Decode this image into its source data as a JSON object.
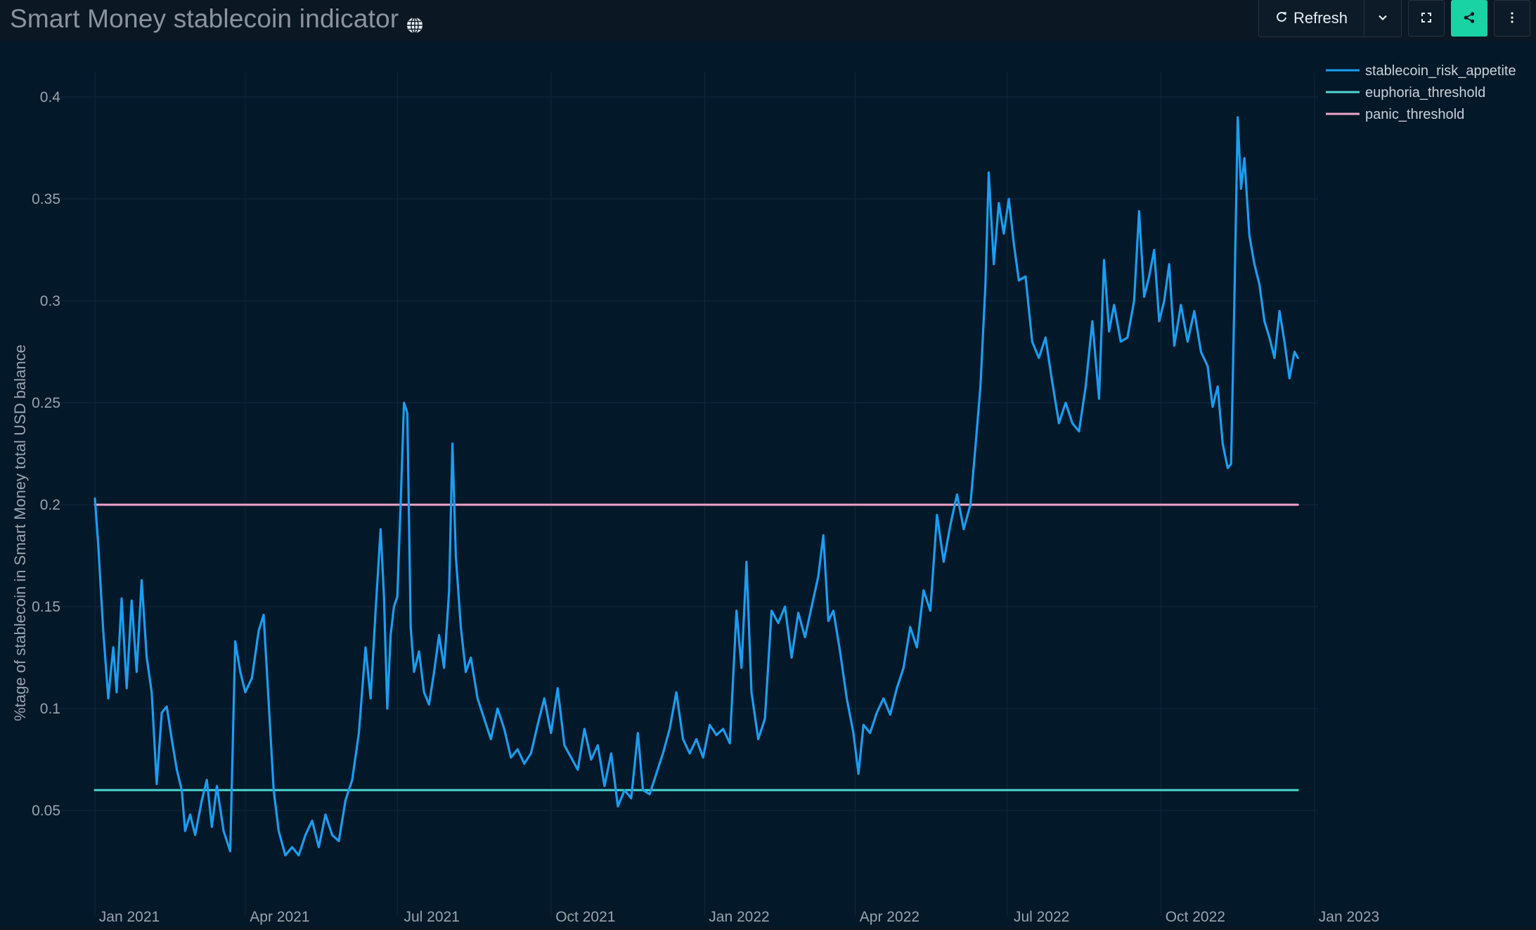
{
  "header": {
    "title": "Smart Money stablecoin indicator",
    "title_icon": "globe-icon",
    "refresh_label": "Refresh",
    "refresh_icon": "refresh-icon",
    "dropdown_icon": "chevron-down-icon",
    "fullscreen_icon": "expand-icon",
    "share_icon": "share-icon",
    "more_icon": "kebab-menu-icon"
  },
  "colors": {
    "page_bg": "#0b1723",
    "plot_bg": "#031829",
    "risk": "#1a9ef2",
    "euphoria": "#4dd6d1",
    "panic": "#f0a3c9",
    "accent": "#19d3a4"
  },
  "chart_data": {
    "type": "line",
    "title": "",
    "xlabel": "",
    "ylabel": "%tage of stablecoin in Smart Money total USD balance",
    "xlim": [
      "2021-01-01",
      "2023-01-01"
    ],
    "ylim": [
      0,
      0.41
    ],
    "x_ticks": [
      "Jan 2021",
      "Apr 2021",
      "Jul 2021",
      "Oct 2021",
      "Jan 2022",
      "Apr 2022",
      "Jul 2022",
      "Oct 2022",
      "Jan 2023"
    ],
    "y_ticks": [
      "0.05",
      "0.1",
      "0.15",
      "0.2",
      "0.25",
      "0.3",
      "0.35",
      "0.4"
    ],
    "grid": true,
    "legend_position": "top-right",
    "series": [
      {
        "name": "stablecoin_risk_appetite",
        "color": "#1a9ef2",
        "points": [
          [
            "2021-01-01",
            0.203
          ],
          [
            "2021-01-03",
            0.18
          ],
          [
            "2021-01-06",
            0.138
          ],
          [
            "2021-01-09",
            0.105
          ],
          [
            "2021-01-12",
            0.13
          ],
          [
            "2021-01-14",
            0.108
          ],
          [
            "2021-01-17",
            0.154
          ],
          [
            "2021-01-20",
            0.11
          ],
          [
            "2021-01-23",
            0.153
          ],
          [
            "2021-01-26",
            0.118
          ],
          [
            "2021-01-29",
            0.163
          ],
          [
            "2021-02-01",
            0.125
          ],
          [
            "2021-02-04",
            0.108
          ],
          [
            "2021-02-07",
            0.063
          ],
          [
            "2021-02-10",
            0.098
          ],
          [
            "2021-02-13",
            0.101
          ],
          [
            "2021-02-16",
            0.085
          ],
          [
            "2021-02-19",
            0.07
          ],
          [
            "2021-02-22",
            0.06
          ],
          [
            "2021-02-24",
            0.04
          ],
          [
            "2021-02-27",
            0.048
          ],
          [
            "2021-03-02",
            0.038
          ],
          [
            "2021-03-06",
            0.055
          ],
          [
            "2021-03-09",
            0.065
          ],
          [
            "2021-03-12",
            0.042
          ],
          [
            "2021-03-15",
            0.062
          ],
          [
            "2021-03-19",
            0.04
          ],
          [
            "2021-03-23",
            0.03
          ],
          [
            "2021-03-26",
            0.133
          ],
          [
            "2021-03-29",
            0.118
          ],
          [
            "2021-04-01",
            0.108
          ],
          [
            "2021-04-05",
            0.115
          ],
          [
            "2021-04-09",
            0.138
          ],
          [
            "2021-04-12",
            0.146
          ],
          [
            "2021-04-15",
            0.103
          ],
          [
            "2021-04-18",
            0.06
          ],
          [
            "2021-04-21",
            0.04
          ],
          [
            "2021-04-25",
            0.028
          ],
          [
            "2021-04-29",
            0.032
          ],
          [
            "2021-05-03",
            0.028
          ],
          [
            "2021-05-07",
            0.038
          ],
          [
            "2021-05-11",
            0.045
          ],
          [
            "2021-05-15",
            0.032
          ],
          [
            "2021-05-19",
            0.048
          ],
          [
            "2021-05-23",
            0.038
          ],
          [
            "2021-05-27",
            0.035
          ],
          [
            "2021-05-31",
            0.055
          ],
          [
            "2021-06-04",
            0.065
          ],
          [
            "2021-06-08",
            0.088
          ],
          [
            "2021-06-12",
            0.13
          ],
          [
            "2021-06-15",
            0.105
          ],
          [
            "2021-06-18",
            0.148
          ],
          [
            "2021-06-21",
            0.188
          ],
          [
            "2021-06-23",
            0.155
          ],
          [
            "2021-06-25",
            0.1
          ],
          [
            "2021-06-27",
            0.136
          ],
          [
            "2021-06-29",
            0.15
          ],
          [
            "2021-07-01",
            0.155
          ],
          [
            "2021-07-03",
            0.2
          ],
          [
            "2021-07-05",
            0.25
          ],
          [
            "2021-07-07",
            0.245
          ],
          [
            "2021-07-09",
            0.14
          ],
          [
            "2021-07-11",
            0.118
          ],
          [
            "2021-07-14",
            0.128
          ],
          [
            "2021-07-17",
            0.108
          ],
          [
            "2021-07-20",
            0.102
          ],
          [
            "2021-07-23",
            0.118
          ],
          [
            "2021-07-26",
            0.136
          ],
          [
            "2021-07-29",
            0.12
          ],
          [
            "2021-08-01",
            0.158
          ],
          [
            "2021-08-03",
            0.23
          ],
          [
            "2021-08-05",
            0.175
          ],
          [
            "2021-08-08",
            0.14
          ],
          [
            "2021-08-11",
            0.118
          ],
          [
            "2021-08-14",
            0.125
          ],
          [
            "2021-08-18",
            0.105
          ],
          [
            "2021-08-22",
            0.095
          ],
          [
            "2021-08-26",
            0.085
          ],
          [
            "2021-08-30",
            0.1
          ],
          [
            "2021-09-03",
            0.09
          ],
          [
            "2021-09-07",
            0.076
          ],
          [
            "2021-09-11",
            0.08
          ],
          [
            "2021-09-15",
            0.073
          ],
          [
            "2021-09-19",
            0.078
          ],
          [
            "2021-09-23",
            0.092
          ],
          [
            "2021-09-27",
            0.105
          ],
          [
            "2021-10-01",
            0.088
          ],
          [
            "2021-10-05",
            0.11
          ],
          [
            "2021-10-09",
            0.082
          ],
          [
            "2021-10-13",
            0.076
          ],
          [
            "2021-10-17",
            0.07
          ],
          [
            "2021-10-21",
            0.09
          ],
          [
            "2021-10-25",
            0.075
          ],
          [
            "2021-10-29",
            0.082
          ],
          [
            "2021-11-02",
            0.062
          ],
          [
            "2021-11-06",
            0.078
          ],
          [
            "2021-11-10",
            0.052
          ],
          [
            "2021-11-14",
            0.06
          ],
          [
            "2021-11-18",
            0.056
          ],
          [
            "2021-11-22",
            0.088
          ],
          [
            "2021-11-25",
            0.06
          ],
          [
            "2021-11-29",
            0.058
          ],
          [
            "2021-12-03",
            0.068
          ],
          [
            "2021-12-07",
            0.078
          ],
          [
            "2021-12-11",
            0.09
          ],
          [
            "2021-12-15",
            0.108
          ],
          [
            "2021-12-19",
            0.085
          ],
          [
            "2021-12-23",
            0.078
          ],
          [
            "2021-12-27",
            0.085
          ],
          [
            "2021-12-31",
            0.076
          ],
          [
            "2022-01-04",
            0.092
          ],
          [
            "2022-01-08",
            0.087
          ],
          [
            "2022-01-12",
            0.09
          ],
          [
            "2022-01-16",
            0.083
          ],
          [
            "2022-01-20",
            0.148
          ],
          [
            "2022-01-23",
            0.12
          ],
          [
            "2022-01-26",
            0.172
          ],
          [
            "2022-01-29",
            0.108
          ],
          [
            "2022-02-02",
            0.085
          ],
          [
            "2022-02-06",
            0.095
          ],
          [
            "2022-02-10",
            0.148
          ],
          [
            "2022-02-14",
            0.142
          ],
          [
            "2022-02-18",
            0.15
          ],
          [
            "2022-02-22",
            0.125
          ],
          [
            "2022-02-26",
            0.147
          ],
          [
            "2022-03-02",
            0.135
          ],
          [
            "2022-03-06",
            0.15
          ],
          [
            "2022-03-10",
            0.165
          ],
          [
            "2022-03-13",
            0.185
          ],
          [
            "2022-03-16",
            0.143
          ],
          [
            "2022-03-19",
            0.148
          ],
          [
            "2022-03-23",
            0.128
          ],
          [
            "2022-03-27",
            0.105
          ],
          [
            "2022-03-31",
            0.088
          ],
          [
            "2022-04-03",
            0.068
          ],
          [
            "2022-04-06",
            0.092
          ],
          [
            "2022-04-10",
            0.088
          ],
          [
            "2022-04-14",
            0.098
          ],
          [
            "2022-04-18",
            0.105
          ],
          [
            "2022-04-22",
            0.097
          ],
          [
            "2022-04-26",
            0.11
          ],
          [
            "2022-04-30",
            0.12
          ],
          [
            "2022-05-04",
            0.14
          ],
          [
            "2022-05-08",
            0.13
          ],
          [
            "2022-05-12",
            0.158
          ],
          [
            "2022-05-16",
            0.148
          ],
          [
            "2022-05-20",
            0.195
          ],
          [
            "2022-05-24",
            0.172
          ],
          [
            "2022-05-28",
            0.19
          ],
          [
            "2022-06-01",
            0.205
          ],
          [
            "2022-06-05",
            0.188
          ],
          [
            "2022-06-09",
            0.2
          ],
          [
            "2022-06-12",
            0.228
          ],
          [
            "2022-06-15",
            0.258
          ],
          [
            "2022-06-18",
            0.308
          ],
          [
            "2022-06-20",
            0.363
          ],
          [
            "2022-06-23",
            0.318
          ],
          [
            "2022-06-26",
            0.348
          ],
          [
            "2022-06-29",
            0.333
          ],
          [
            "2022-07-02",
            0.35
          ],
          [
            "2022-07-05",
            0.328
          ],
          [
            "2022-07-08",
            0.31
          ],
          [
            "2022-07-12",
            0.312
          ],
          [
            "2022-07-16",
            0.28
          ],
          [
            "2022-07-20",
            0.272
          ],
          [
            "2022-07-24",
            0.282
          ],
          [
            "2022-07-28",
            0.26
          ],
          [
            "2022-08-01",
            0.24
          ],
          [
            "2022-08-05",
            0.25
          ],
          [
            "2022-08-09",
            0.24
          ],
          [
            "2022-08-13",
            0.236
          ],
          [
            "2022-08-17",
            0.258
          ],
          [
            "2022-08-21",
            0.29
          ],
          [
            "2022-08-25",
            0.252
          ],
          [
            "2022-08-28",
            0.32
          ],
          [
            "2022-08-31",
            0.285
          ],
          [
            "2022-09-03",
            0.298
          ],
          [
            "2022-09-07",
            0.28
          ],
          [
            "2022-09-11",
            0.282
          ],
          [
            "2022-09-15",
            0.3
          ],
          [
            "2022-09-18",
            0.344
          ],
          [
            "2022-09-21",
            0.302
          ],
          [
            "2022-09-24",
            0.312
          ],
          [
            "2022-09-27",
            0.325
          ],
          [
            "2022-09-30",
            0.29
          ],
          [
            "2022-10-03",
            0.3
          ],
          [
            "2022-10-06",
            0.318
          ],
          [
            "2022-10-09",
            0.278
          ],
          [
            "2022-10-13",
            0.298
          ],
          [
            "2022-10-17",
            0.28
          ],
          [
            "2022-10-21",
            0.295
          ],
          [
            "2022-10-25",
            0.275
          ],
          [
            "2022-10-29",
            0.268
          ],
          [
            "2022-11-01",
            0.248
          ],
          [
            "2022-11-04",
            0.258
          ],
          [
            "2022-11-07",
            0.23
          ],
          [
            "2022-11-10",
            0.218
          ],
          [
            "2022-11-12",
            0.22
          ],
          [
            "2022-11-14",
            0.3
          ],
          [
            "2022-11-16",
            0.39
          ],
          [
            "2022-11-18",
            0.355
          ],
          [
            "2022-11-20",
            0.37
          ],
          [
            "2022-11-23",
            0.332
          ],
          [
            "2022-11-26",
            0.318
          ],
          [
            "2022-11-29",
            0.308
          ],
          [
            "2022-12-02",
            0.29
          ],
          [
            "2022-12-05",
            0.282
          ],
          [
            "2022-12-08",
            0.272
          ],
          [
            "2022-12-11",
            0.295
          ],
          [
            "2022-12-14",
            0.28
          ],
          [
            "2022-12-17",
            0.262
          ],
          [
            "2022-12-20",
            0.275
          ],
          [
            "2022-12-22",
            0.272
          ]
        ]
      },
      {
        "name": "euphoria_threshold",
        "color": "#4dd6d1",
        "points": [
          [
            "2021-01-01",
            0.06
          ],
          [
            "2022-12-22",
            0.06
          ]
        ]
      },
      {
        "name": "panic_threshold",
        "color": "#f0a3c9",
        "points": [
          [
            "2021-01-01",
            0.2
          ],
          [
            "2022-12-22",
            0.2
          ]
        ]
      }
    ]
  }
}
